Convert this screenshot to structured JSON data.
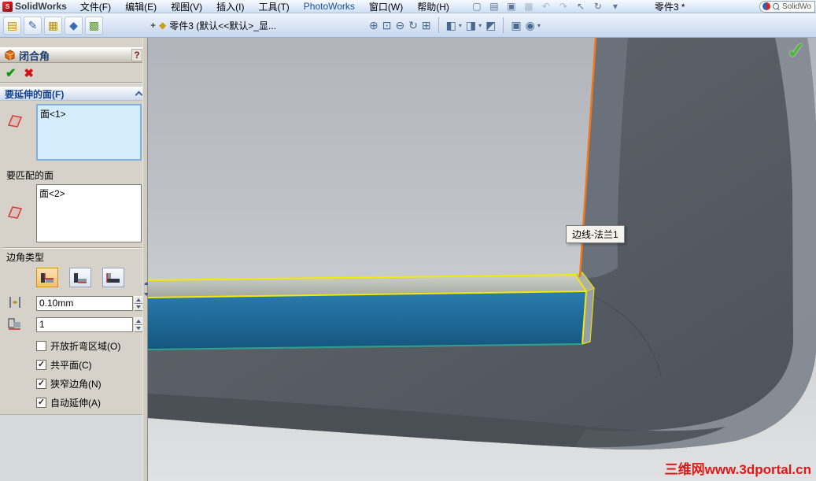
{
  "titlebar": {
    "app_name": "SolidWorks",
    "logo_mark": "S",
    "menus": [
      "文件(F)",
      "编辑(E)",
      "视图(V)",
      "插入(I)",
      "工具(T)",
      "PhotoWorks",
      "窗口(W)",
      "帮助(H)"
    ],
    "doc_title": "零件3 *",
    "search_text": "SolidWo",
    "std_icons": [
      {
        "name": "new-document-icon",
        "glyph": "▢"
      },
      {
        "name": "open-icon",
        "glyph": "▤"
      },
      {
        "name": "save-icon",
        "glyph": "▣"
      },
      {
        "name": "print-icon",
        "glyph": "▦"
      },
      {
        "name": "undo-icon",
        "glyph": "↶"
      },
      {
        "name": "redo-icon",
        "glyph": "↷"
      },
      {
        "name": "select-icon",
        "glyph": "↖"
      },
      {
        "name": "rebuild-icon",
        "glyph": "↻"
      },
      {
        "name": "options-icon",
        "glyph": "▾"
      }
    ]
  },
  "toolbar": {
    "doc_info_prefix": "+",
    "doc_info_icon": "◆",
    "doc_info": "零件3 (默认<<默认>_显...",
    "caret": "▾",
    "feature_icons": [
      {
        "name": "sheet-metal-icon",
        "glyph": "▤"
      },
      {
        "name": "sketch-icon",
        "glyph": "✎"
      },
      {
        "name": "features-icon",
        "glyph": "▦"
      },
      {
        "name": "move-icon",
        "glyph": "◆"
      },
      {
        "name": "pattern-icon",
        "glyph": "▩"
      }
    ],
    "view_icons": [
      {
        "name": "zoom-fit-icon",
        "glyph": "⊕"
      },
      {
        "name": "zoom-area-icon",
        "glyph": "⊡"
      },
      {
        "name": "zoom-in-out-icon",
        "glyph": "⊖"
      },
      {
        "name": "rotate-view-icon",
        "glyph": "↻"
      },
      {
        "name": "pan-icon",
        "glyph": "⊞"
      },
      {
        "name": "view-orientation-icon",
        "glyph": "◧"
      },
      {
        "name": "display-style-icon",
        "glyph": "◨"
      },
      {
        "name": "section-view-icon",
        "glyph": "◩"
      },
      {
        "name": "camera-icon",
        "glyph": "▣"
      },
      {
        "name": "render-icon",
        "glyph": "◉"
      }
    ]
  },
  "pm": {
    "title": "闭合角",
    "help_label": "?",
    "ok_glyph": "✔",
    "cancel_glyph": "✖",
    "faces_to_extend": {
      "header": "要延伸的面(F)",
      "items": [
        "面<1>"
      ]
    },
    "faces_to_match": {
      "label": "要匹配的面",
      "items": [
        "面<2>"
      ]
    },
    "corner_type": {
      "label": "边角类型",
      "options": [
        {
          "name": "butt",
          "selected": true
        },
        {
          "name": "overlap",
          "selected": false
        },
        {
          "name": "underlap",
          "selected": false
        }
      ]
    },
    "gap_distance": {
      "value": "0.10mm"
    },
    "overlap_ratio": {
      "value": "1"
    },
    "checkboxes": [
      {
        "label": "开放折弯区域(O)",
        "checked": false,
        "mark": ""
      },
      {
        "label": "共平面(C)",
        "checked": true,
        "mark": "✓"
      },
      {
        "label": "狭窄边角(N)",
        "checked": true,
        "mark": "✓"
      },
      {
        "label": "自动延伸(A)",
        "checked": true,
        "mark": "✓"
      }
    ]
  },
  "viewport": {
    "tooltip": "边线-法兰1",
    "confirm_check": "✓",
    "watermark": "三维网www.3dportal.cn"
  },
  "colors": {
    "selection_fill": "#d4ecfb",
    "highlight_edge_yellow": "#f2ea00",
    "preview_edge_orange": "#f07818",
    "face_blue": "#1d6b9e",
    "watermark_red": "#e01818"
  }
}
